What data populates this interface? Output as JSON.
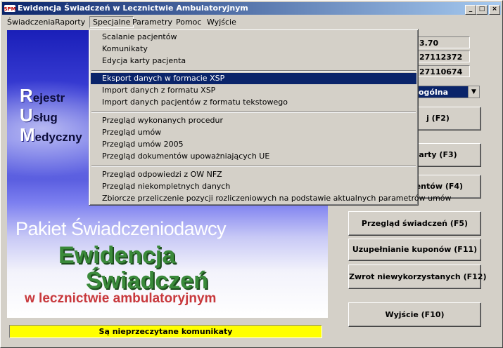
{
  "window": {
    "title": "Ewidencja Świadczeń w Lecznictwie Ambulatoryjnym",
    "minimize_glyph": "_",
    "maximize_glyph": "□",
    "close_glyph": "×",
    "app_icon": "spm-logo-icon"
  },
  "menubar": {
    "items": [
      "Świadczenia",
      "Raporty",
      "Specjalne",
      "Parametry",
      "Pomoc",
      "Wyjście"
    ],
    "open_index": 2
  },
  "dropdown": {
    "groups": [
      [
        "Scalanie pacjentów",
        "Komunikaty",
        "Edycja karty pacjenta"
      ],
      [
        "Eksport danych w formacie XSP",
        "Import danych z formatu XSP",
        "Import danych pacjentów z formatu tekstowego"
      ],
      [
        "Przegląd wykonanych procedur",
        "Przegląd umów",
        "Przegląd umów 2005",
        "Przegląd dokumentów upoważniających UE"
      ],
      [
        "Przegląd odpowiedzi z OW NFZ",
        "Przegląd niekompletnych danych",
        "Zbiorcze przeliczenie pozycji rozliczeniowych na podstawie aktualnych parametrów umów"
      ]
    ],
    "selected": "Eksport danych w formacie XSP"
  },
  "banner": {
    "rum": [
      {
        "letter": "R",
        "rest": "ejestr"
      },
      {
        "letter": "U",
        "rest": "sług"
      },
      {
        "letter": "M",
        "rest": "edyczny"
      }
    ],
    "pakiet": "Pakiet Świadczeniodawcy",
    "line1": "Ewidencja",
    "line2": "Świadczeń",
    "line3": "w lecznictwie ambulatoryjnym"
  },
  "right_panel": {
    "version": "3.70",
    "field2": "27112372",
    "field3": "27110674",
    "combo_value": "ogólna",
    "combo_arrow": "▼",
    "buttons": {
      "b1": "j (F2)",
      "b2": "arty (F3)",
      "b3": "jentów (F4)",
      "przeglad": "Przegląd świadczeń (F5)",
      "kupony": "Uzupełnianie kuponów (F11)",
      "zwrot": "Zwrot niewykorzystanych (F12)",
      "wyjscie": "Wyjście (F10)"
    }
  },
  "status_text": "Są nieprzeczytane komunikaty",
  "colors": {
    "titlebar_start": "#0a246a",
    "titlebar_end": "#a6caf0",
    "status_bg": "#ffff00",
    "ewidencja_green": "#3a8a3a",
    "ambul_red": "#c8383c"
  }
}
